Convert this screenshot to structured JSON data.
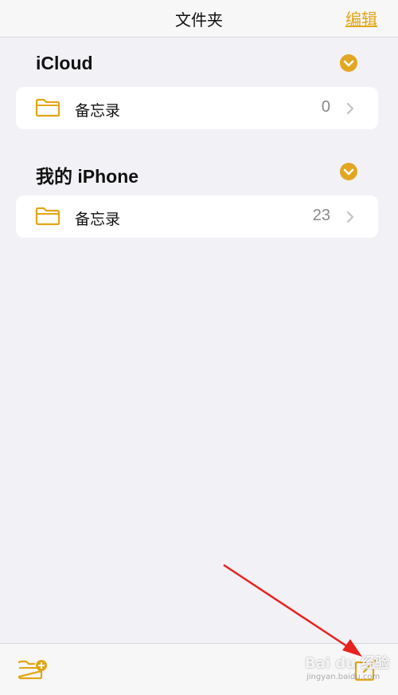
{
  "header": {
    "title": "文件夹",
    "edit_label": "编辑"
  },
  "sections": [
    {
      "title": "iCloud",
      "folders": [
        {
          "name": "备忘录",
          "count": "0"
        }
      ]
    },
    {
      "title": "我的 iPhone",
      "folders": [
        {
          "name": "备忘录",
          "count": "23"
        }
      ]
    }
  ],
  "toolbar": {
    "new_folder_icon": "folder-plus-icon",
    "compose_icon": "compose-icon"
  },
  "watermark": {
    "text": "Bai du 经验",
    "sub": "jingyan.baidu.com"
  },
  "colors": {
    "accent": "#e3a514",
    "background": "#f2f1f6",
    "card": "#ffffff",
    "count": "#8a8a8e",
    "annotation_arrow": "#e8231e"
  }
}
